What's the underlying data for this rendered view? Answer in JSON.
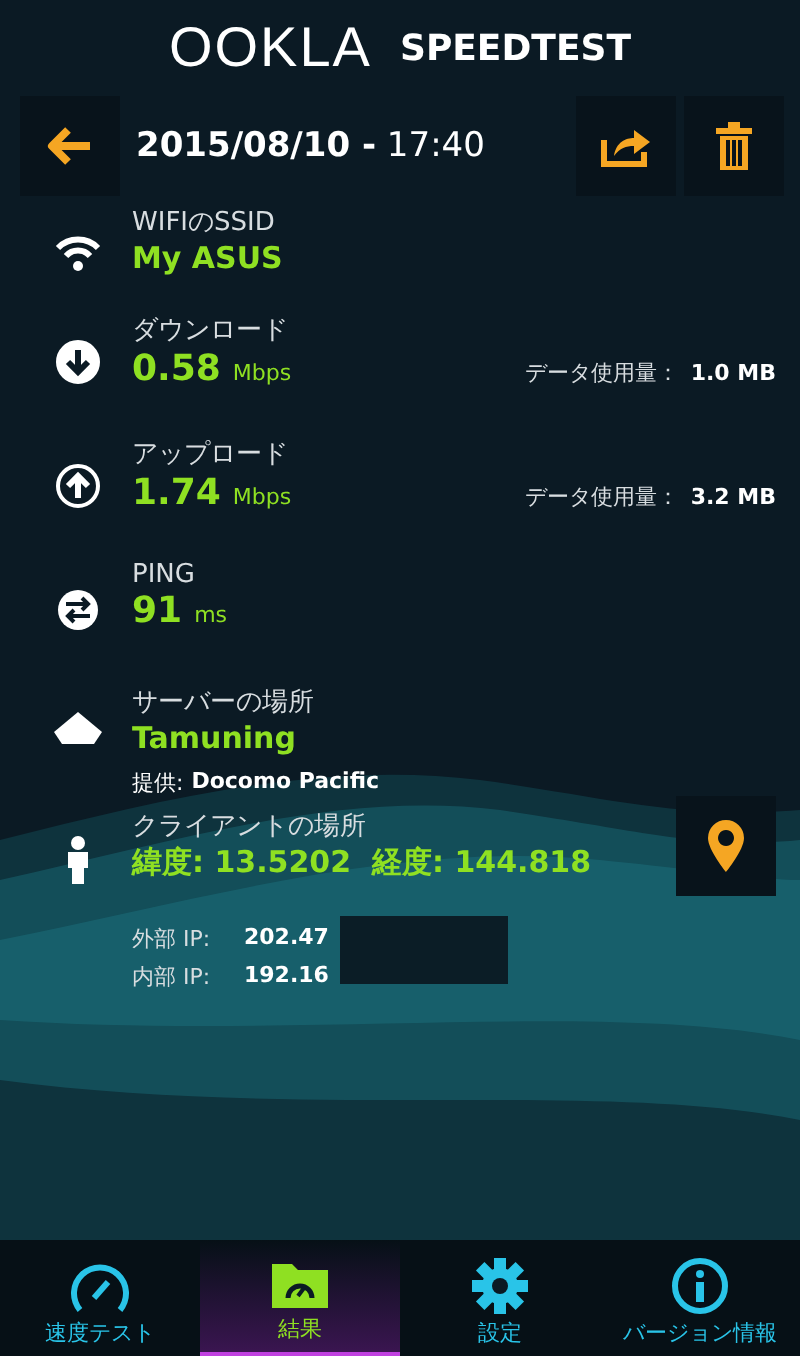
{
  "header": {
    "logo": "OOKLA",
    "title": "SPEEDTEST"
  },
  "toolbar": {
    "datetime": "**2015/08/10 -** 17:40"
  },
  "items": [
    {
      "kind": "wifi",
      "label": "WIFIのSSID",
      "value": "My ASUS"
    },
    {
      "kind": "download",
      "label": "ダウンロード",
      "value": "0.58",
      "unit": "Mbps",
      "usage_label": "データ使用量：",
      "usage": "1.0 MB"
    },
    {
      "kind": "upload",
      "label": "アップロード",
      "value": "1.74",
      "unit": "Mbps",
      "usage_label": "データ使用量：",
      "usage": "3.2 MB"
    },
    {
      "kind": "ping",
      "label": "PING",
      "value": "91",
      "unit": "ms"
    },
    {
      "kind": "server",
      "label": "サーバーの場所",
      "value": "Tamuning",
      "provider_label": "提供:",
      "provider": "Docomo Pacific"
    },
    {
      "kind": "client",
      "label": "クライアントの場所",
      "value": "緯度: 13.5202  経度: 144.818"
    }
  ],
  "ips": [
    {
      "label": "外部 IP:",
      "value": "202.47"
    },
    {
      "label": "内部 IP:",
      "value": "192.16"
    }
  ],
  "nav": [
    {
      "kind": "speed",
      "label": "速度テスト",
      "selected": false
    },
    {
      "kind": "results",
      "label": "結果",
      "selected": true
    },
    {
      "kind": "settings",
      "label": "設定",
      "selected": false
    },
    {
      "kind": "info",
      "label": "バージョン情報",
      "selected": false
    }
  ]
}
